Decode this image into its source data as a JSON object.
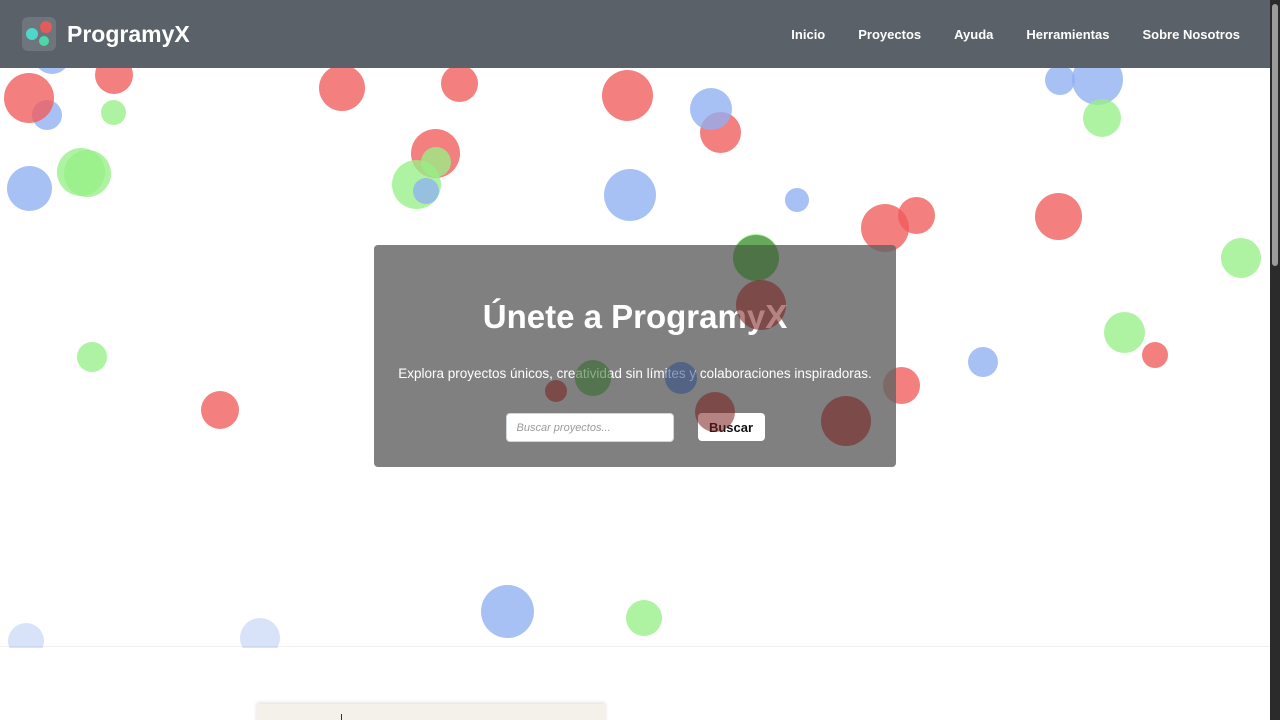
{
  "header": {
    "brand": "ProgramyX",
    "nav": [
      "Inicio",
      "Proyectos",
      "Ayuda",
      "Herramientas",
      "Sobre Nosotros"
    ]
  },
  "hero": {
    "title": "Únete a ProgramyX",
    "subtitle": "Explora proyectos únicos, creatividad sin límites y colaboraciones inspiradoras.",
    "search_placeholder": "Buscar proyectos...",
    "search_button": "Buscar"
  },
  "colors": {
    "navbar": "#5a6168",
    "bubble_red": "#ef5b5b",
    "bubble_blue": "#8fb0f2",
    "bubble_green": "#97ef86"
  },
  "icons": {
    "logo": "programyx-logo-icon"
  }
}
